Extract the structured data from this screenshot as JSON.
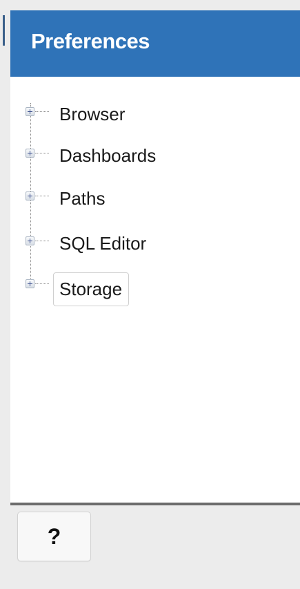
{
  "header": {
    "title": "Preferences"
  },
  "tree": {
    "items": [
      {
        "label": "Browser"
      },
      {
        "label": "Dashboards"
      },
      {
        "label": "Paths"
      },
      {
        "label": "SQL Editor"
      },
      {
        "label": "Storage"
      }
    ],
    "expander_icon": "plus-expander-icon"
  },
  "footer": {
    "help_label": "?"
  },
  "colors": {
    "header_bg": "#2f73b8",
    "header_text": "#ffffff"
  }
}
